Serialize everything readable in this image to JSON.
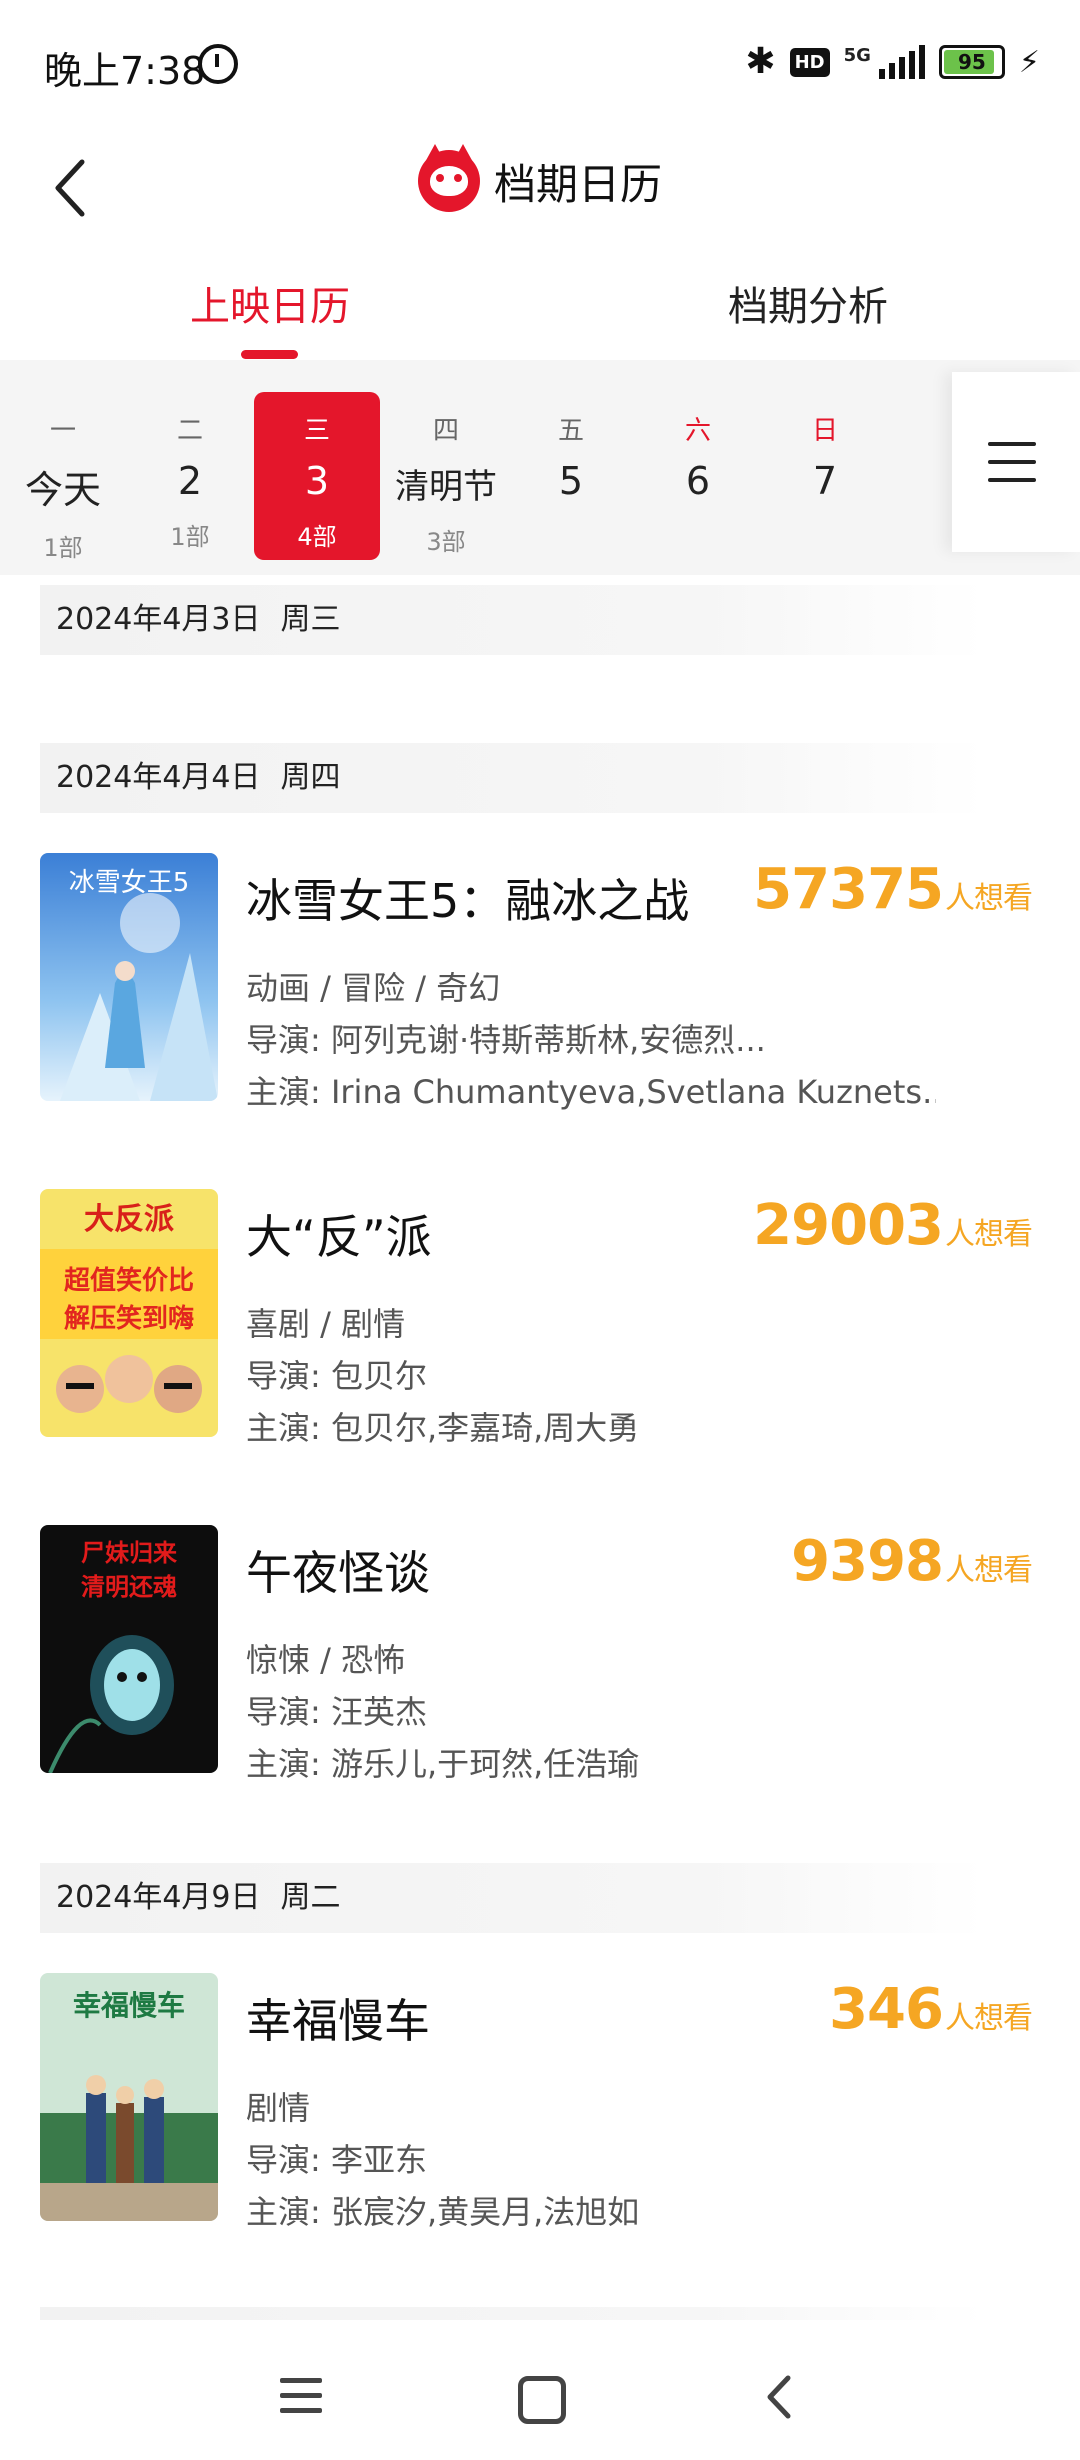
{
  "status_bar": {
    "time": "晚上7:38",
    "network": "5G",
    "hd": "HD",
    "battery": "95"
  },
  "header": {
    "title": "档期日历"
  },
  "tabs": [
    {
      "label": "上映日历",
      "active": true
    },
    {
      "label": "档期分析",
      "active": false
    }
  ],
  "calendar": {
    "days": [
      {
        "weekday": "一",
        "date": "今天",
        "count": "1部"
      },
      {
        "weekday": "二",
        "date": "2",
        "count": "1部"
      },
      {
        "weekday": "三",
        "date": "3",
        "count": "4部",
        "selected": true
      },
      {
        "weekday": "四",
        "date": "清明节",
        "count": "3部"
      },
      {
        "weekday": "五",
        "date": "5",
        "count": ""
      },
      {
        "weekday": "六",
        "date": "6",
        "count": "",
        "weekend": true
      },
      {
        "weekday": "日",
        "date": "7",
        "count": "",
        "weekend": true
      }
    ]
  },
  "groups": [
    {
      "date": "2024年4月3日",
      "weekday": "周三"
    },
    {
      "date": "2024年4月4日",
      "weekday": "周四"
    },
    {
      "date": "2024年4月9日",
      "weekday": "周二"
    }
  ],
  "movies": [
    {
      "title": "冰雪女王5：融冰之战",
      "want_count": "57375",
      "want_suffix": "人想看",
      "genres": "动画 / 冒险 / 奇幻",
      "director": "导演: 阿列克谢·特斯蒂斯林,安德烈...",
      "cast": "主演: Irina Chumantyeva,Svetlana Kuznets...",
      "poster_text": "冰雪女王5"
    },
    {
      "title": "大“反”派",
      "want_count": "29003",
      "want_suffix": "人想看",
      "genres": "喜剧 / 剧情",
      "director": "导演: 包贝尔",
      "cast": "主演: 包贝尔,李嘉琦,周大勇",
      "poster_text": "大反派"
    },
    {
      "title": "午夜怪谈",
      "want_count": "9398",
      "want_suffix": "人想看",
      "genres": "惊悚 / 恐怖",
      "director": "导演: 汪英杰",
      "cast": "主演: 游乐儿,于珂然,任浩瑜",
      "poster_text": "尸妹归来 清明还魂"
    },
    {
      "title": "幸福慢车",
      "want_count": "346",
      "want_suffix": "人想看",
      "genres": "剧情",
      "director": "导演: 李亚东",
      "cast": "主演: 张宸汐,黄昊月,法旭如",
      "poster_text": "幸福慢车"
    }
  ]
}
